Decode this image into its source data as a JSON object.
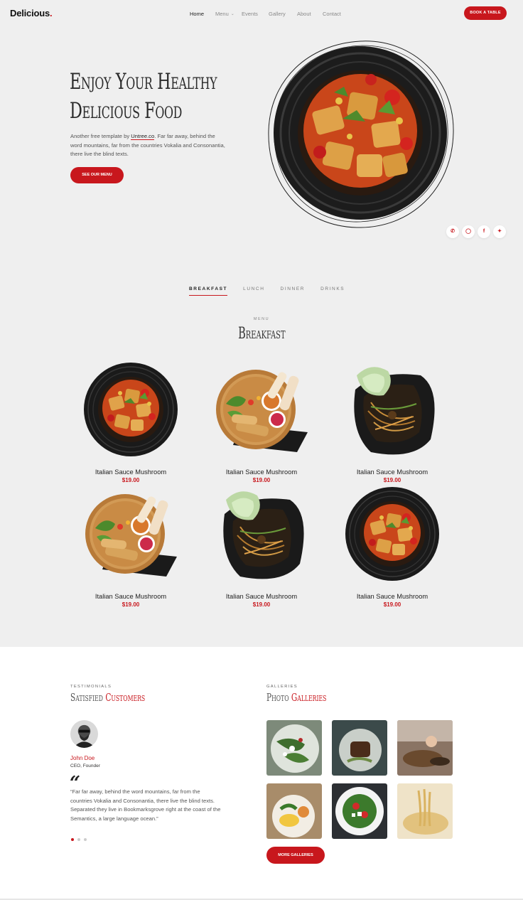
{
  "brand": {
    "name": "Delicious",
    "dot": "."
  },
  "nav": {
    "home": "Home",
    "menu": "Menu",
    "events": "Events",
    "gallery": "Gallery",
    "about": "About",
    "contact": "Contact"
  },
  "header": {
    "book_label": "BOOK A TABLE"
  },
  "hero": {
    "title_line1": "Enjoy Your Healthy",
    "title_line2": "Delicious Food",
    "text_before": "Another free template by ",
    "text_link": "Untree.co",
    "text_after": ". Far far away, behind the word mountains, far from the countries Vokalia and Consonantia, there live the blind texts.",
    "button_label": "SEE OUR MENU"
  },
  "socials": {
    "whatsapp": "whatsapp-icon",
    "instagram": "instagram-icon",
    "facebook": "facebook-icon",
    "twitter": "twitter-icon"
  },
  "tabs": [
    "BREAKFAST",
    "LUNCH",
    "DINNER",
    "DRINKS"
  ],
  "menu": {
    "label": "MENU",
    "title": "Breakfast",
    "items": [
      {
        "name": "Italian Sauce Mushroom",
        "price": "$19.00"
      },
      {
        "name": "Italian Sauce Mushroom",
        "price": "$19.00"
      },
      {
        "name": "Italian Sauce Mushroom",
        "price": "$19.00"
      },
      {
        "name": "Italian Sauce Mushroom",
        "price": "$19.00"
      },
      {
        "name": "Italian Sauce Mushroom",
        "price": "$19.00"
      },
      {
        "name": "Italian Sauce Mushroom",
        "price": "$19.00"
      }
    ]
  },
  "testimonials": {
    "label": "TESTIMONIALS",
    "title_a": "Satisfied",
    "title_b": "Customers",
    "name": "John Doe",
    "role": "CEO, Founder",
    "quote_mark": "“",
    "text": "“Far far away, behind the word mountains, far from the countries Vokalia and Consonantia, there live the blind texts. Separated they live in Bookmarksgrove right at the coast of the Semantics, a large language ocean.”"
  },
  "galleries": {
    "label": "GALLERIES",
    "title_a": "Photo",
    "title_b": "Galleries",
    "button_label": "MORE GALLERIES"
  },
  "colors": {
    "accent": "#c8171d",
    "background": "#efefef"
  }
}
